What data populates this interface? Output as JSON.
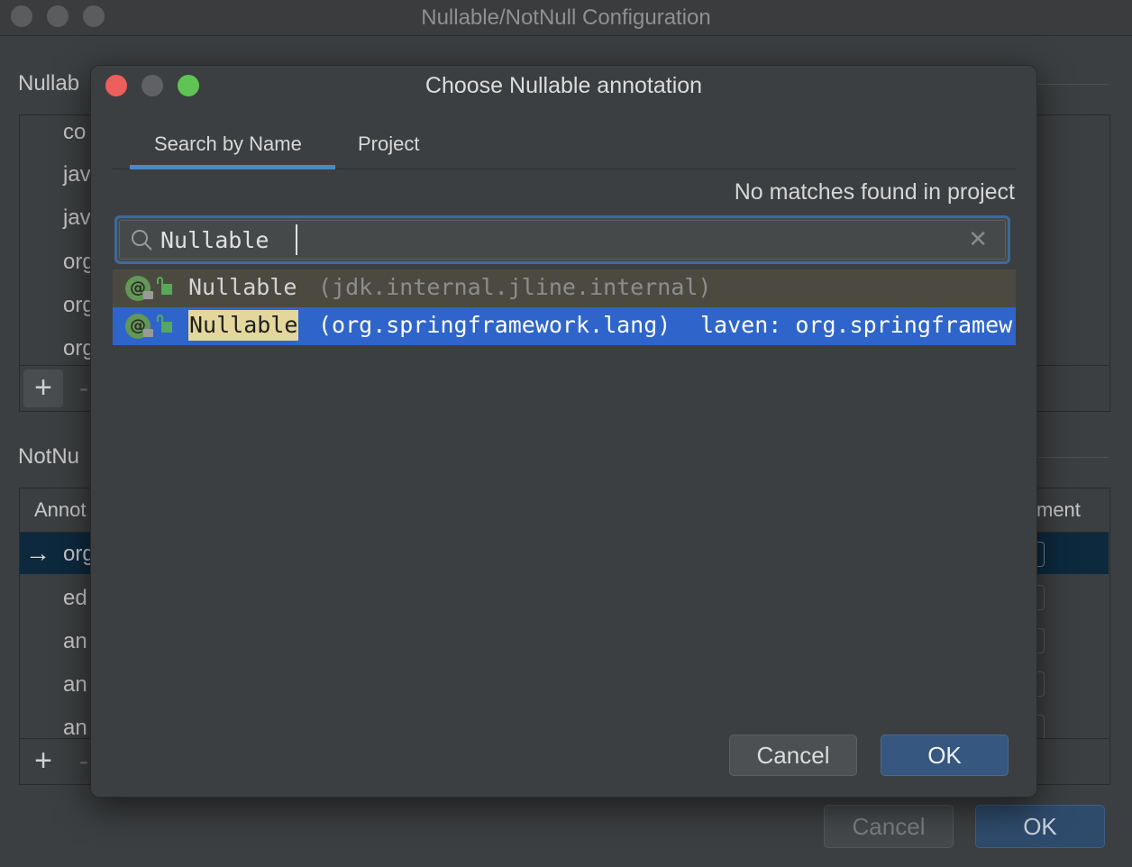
{
  "background_window": {
    "title": "Nullable/NotNull Configuration",
    "nullable_section_label": "Nullab",
    "nullable_rows": [
      "co",
      "jav",
      "jav",
      "org",
      "org",
      "org"
    ],
    "notnull_section_label": "NotNu",
    "table_header_left": "Annot",
    "table_header_right": "ment",
    "notnull_rows": [
      "org",
      "ed",
      "an",
      "an",
      "an"
    ],
    "add_icon": "+",
    "remove_icon": "-",
    "row_arrow": "→",
    "cancel_label": "Cancel",
    "ok_label": "OK"
  },
  "dialog": {
    "title": "Choose Nullable annotation",
    "tabs": [
      {
        "label": "Search by Name",
        "active": true
      },
      {
        "label": "Project",
        "active": false
      }
    ],
    "status_text": "No matches found in project",
    "search": {
      "value": "Nullable",
      "search_icon": "search-icon",
      "clear_icon": "close-icon"
    },
    "results": [
      {
        "name": "Nullable",
        "package": "(jdk.internal.jline.internal)",
        "location": "",
        "selected": false,
        "icon": "annotation-icon"
      },
      {
        "name": "Nullable",
        "package": "(org.springframework.lang)",
        "location": "laven: org.springframew",
        "selected": true,
        "icon": "annotation-icon"
      }
    ],
    "cancel_label": "Cancel",
    "ok_label": "OK"
  },
  "colors": {
    "window_bg": "#3c3f41",
    "selection_blue": "#2f65ca",
    "tab_underline": "#4a88c7",
    "ok_button": "#365880",
    "match_highlight": "#e3d79c",
    "close_light": "#ec5f5a",
    "minimize_light": "#5f6164",
    "zoom_light": "#5fc453"
  }
}
